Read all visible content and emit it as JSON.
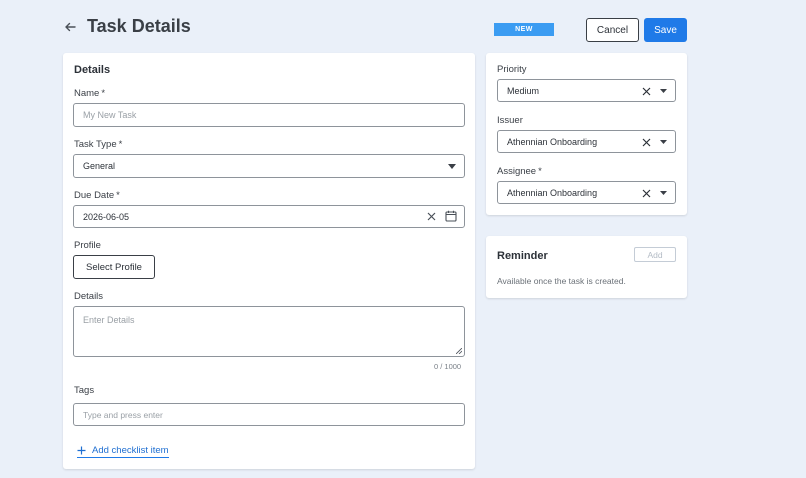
{
  "header": {
    "title": "Task Details",
    "status_badge": "NEW",
    "cancel_label": "Cancel",
    "save_label": "Save"
  },
  "details": {
    "section_title": "Details",
    "name": {
      "label": "Name",
      "required": "*",
      "placeholder": "My New Task",
      "value": ""
    },
    "task_type": {
      "label": "Task Type",
      "required": "*",
      "value": "General"
    },
    "due_date": {
      "label": "Due Date",
      "required": "*",
      "value": "2026-06-05"
    },
    "profile": {
      "label": "Profile",
      "button_label": "Select Profile"
    },
    "details_field": {
      "label": "Details",
      "placeholder": "Enter Details",
      "char_count": "0 / 1000"
    },
    "tags": {
      "label": "Tags",
      "placeholder": "Type and press enter"
    },
    "add_checklist_label": "Add checklist item"
  },
  "meta": {
    "priority": {
      "label": "Priority",
      "value": "Medium"
    },
    "issuer": {
      "label": "Issuer",
      "value": "Athennian Onboarding"
    },
    "assignee": {
      "label": "Assignee",
      "required": "*",
      "value": "Athennian Onboarding"
    }
  },
  "reminder": {
    "title": "Reminder",
    "add_label": "Add",
    "note": "Available once the task is created."
  },
  "colors": {
    "background": "#eaf0f9",
    "accent": "#1f7ae8",
    "badge": "#3b9cf2",
    "link": "#1f6fd1"
  },
  "icons": [
    "back-arrow-icon",
    "chevron-down-icon",
    "close-icon",
    "calendar-icon",
    "plus-icon",
    "resize-grip-icon"
  ]
}
